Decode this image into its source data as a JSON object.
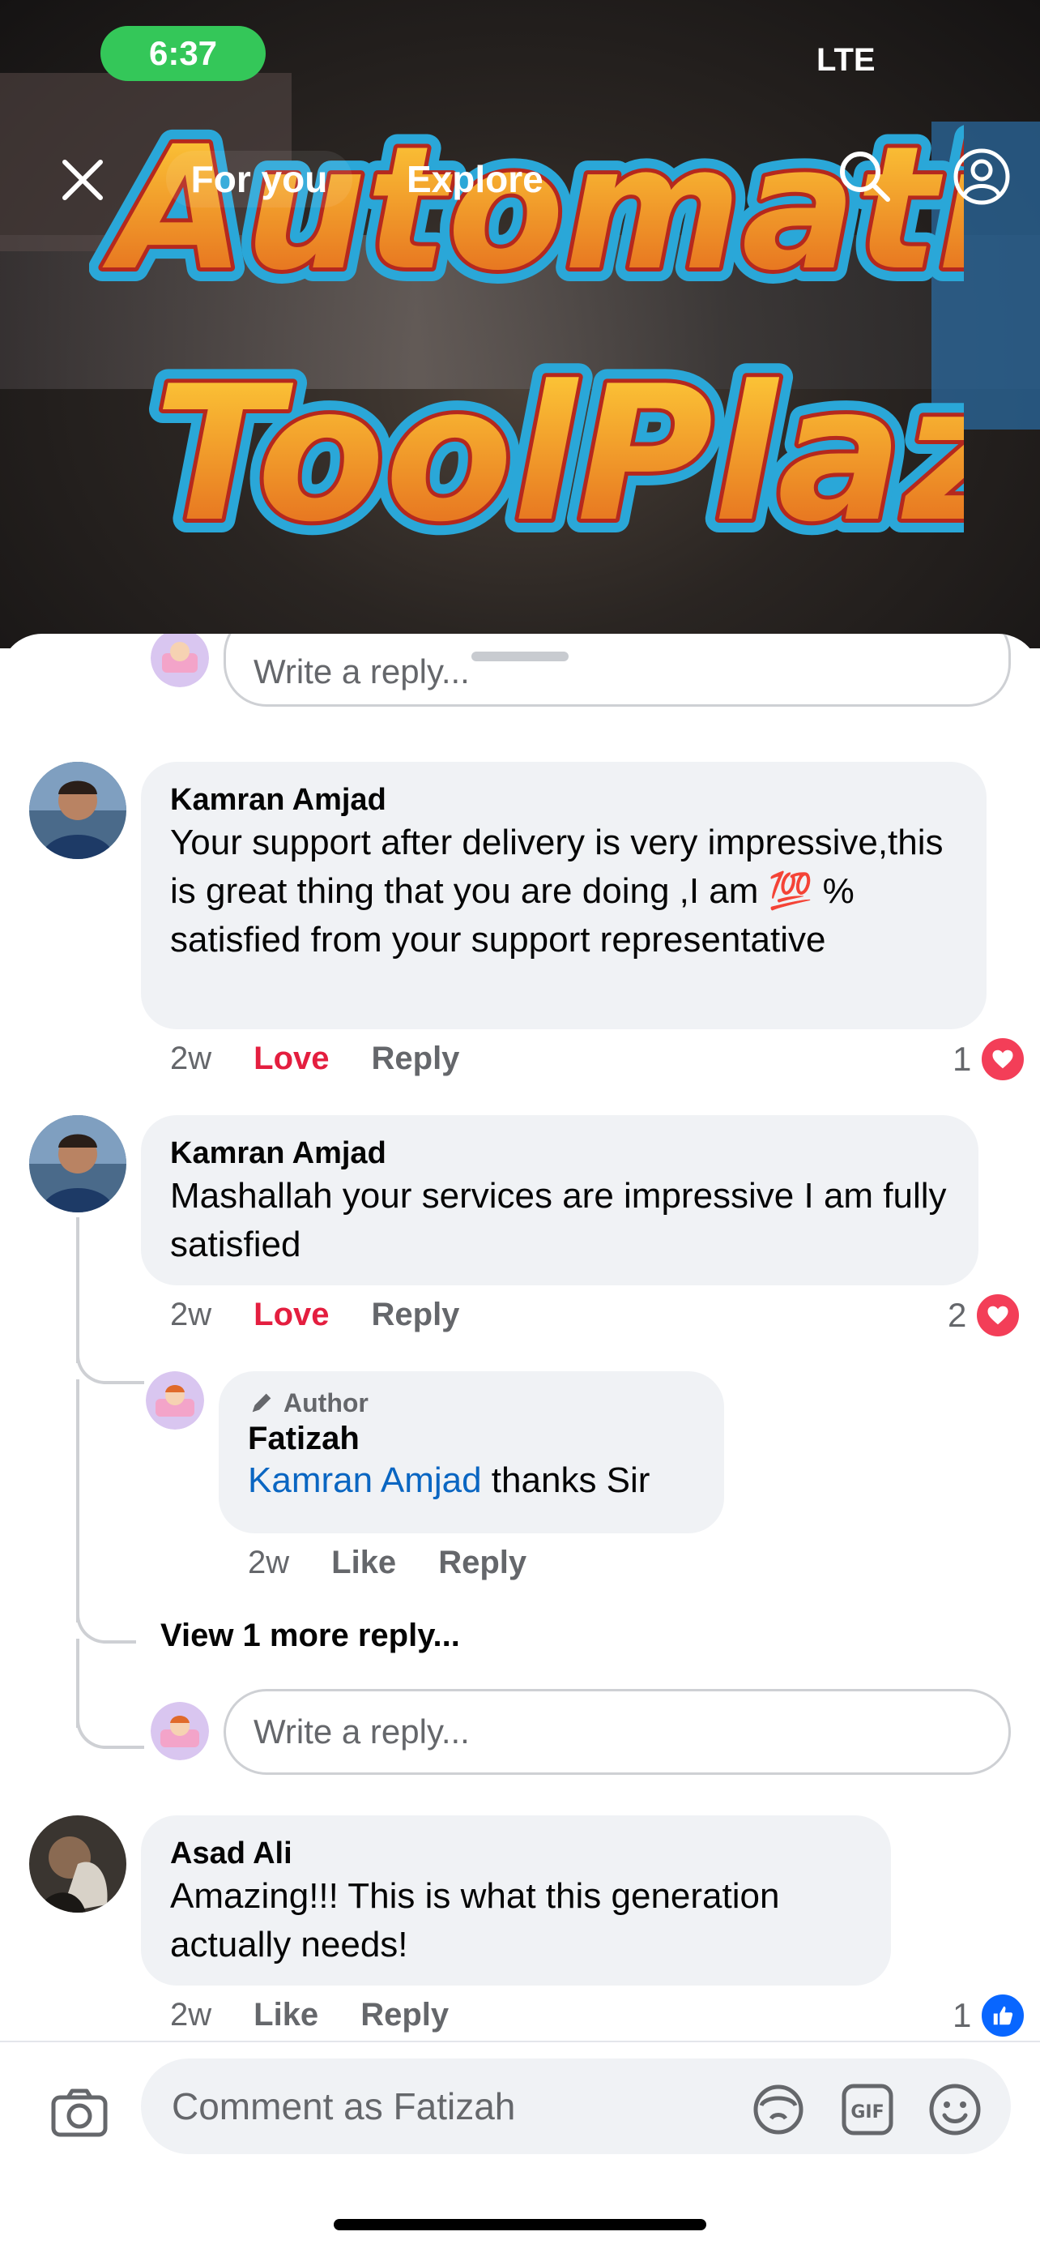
{
  "status_bar": {
    "time": "6:37",
    "network": "LTE"
  },
  "top_nav": {
    "tab_for_you": "For you",
    "tab_explore": "Explore"
  },
  "video": {
    "logo_text_line1": "Automatic",
    "logo_text_line2": "ToolPlaza"
  },
  "comments": [
    {
      "name": "Kamran Amjad",
      "text": "Your support after delivery is very impressive,this is great thing that you are doing ,I am 💯 % satisfied from your support representative",
      "time": "2w",
      "reaction_label": "Love",
      "reply_label": "Reply",
      "reaction_count": "1",
      "reaction_type": "love"
    },
    {
      "name": "Kamran Amjad",
      "text": "Mashallah your services are impressive I am fully satisfied",
      "time": "2w",
      "reaction_label": "Love",
      "reply_label": "Reply",
      "reaction_count": "2",
      "reaction_type": "love"
    },
    {
      "name": "Asad Ali",
      "text": "Amazing!!! This is what this generation actually needs!",
      "time": "2w",
      "reaction_label": "Like",
      "reply_label": "Reply",
      "reaction_count": "1",
      "reaction_type": "like"
    }
  ],
  "reply": {
    "author_tag": "Author",
    "name": "Fatizah",
    "mention": "Kamran Amjad",
    "text": " thanks Sir",
    "time": "2w",
    "like_label": "Like",
    "reply_label": "Reply"
  },
  "view_more_replies": "View 1 more reply...",
  "reply_input_placeholder": "Write a reply...",
  "top_reply_input_placeholder": "Write a reply...",
  "composer": {
    "placeholder": "Comment as Fatizah"
  },
  "colors": {
    "love": "#e41e3f",
    "like": "#0866ff",
    "mention": "#0a66c2",
    "status_green": "#34c759"
  },
  "icons": [
    "close-icon",
    "search-icon",
    "profile-icon",
    "camera-icon",
    "avatar-sticker-icon",
    "gif-icon",
    "emoji-icon",
    "pencil-icon",
    "heart-icon",
    "thumbs-up-icon"
  ]
}
